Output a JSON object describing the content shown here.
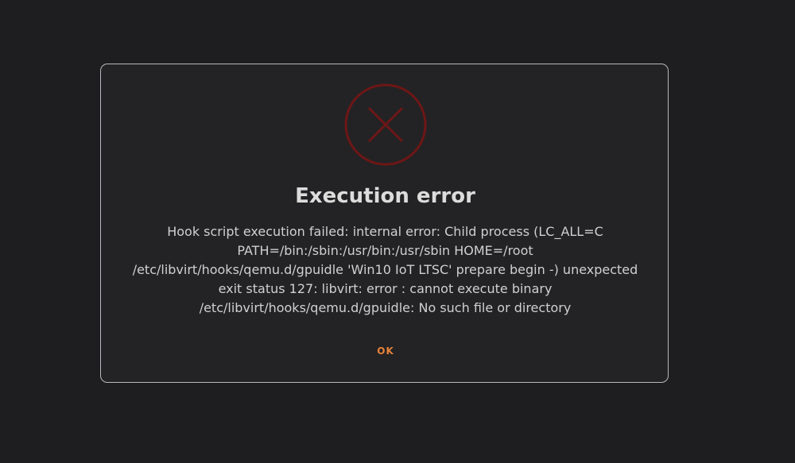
{
  "dialog": {
    "icon": "error-circle-x-icon",
    "icon_color": "#6e1616",
    "title": "Execution error",
    "message_lines": [
      "Hook script execution failed: internal error: Child process (LC_ALL=C",
      "PATH=/bin:/sbin:/usr/bin:/usr/sbin HOME=/root",
      "/etc/libvirt/hooks/qemu.d/gpuidle 'Win10 IoT LTSC' prepare begin -) unexpected",
      "exit status 127: libvirt:  error : cannot execute binary",
      "/etc/libvirt/hooks/qemu.d/gpuidle: No such file or directory"
    ],
    "ok_label": "OK",
    "accent_color": "#e8823a"
  }
}
